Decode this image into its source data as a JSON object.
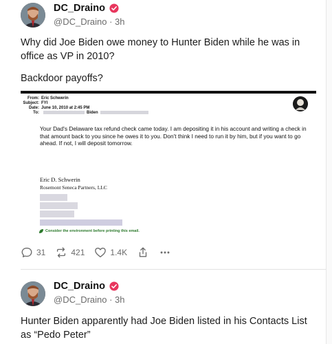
{
  "posts": [
    {
      "username": "DC_Draino",
      "handle_time": "@DC_Draino · 3h",
      "paragraphs": [
        "Why did Joe Biden owe money to Hunter Biden while he was in office as VP in 2010?",
        "Backdoor payoffs?"
      ],
      "email": {
        "from_label": "From:",
        "from_value": "Eric Schwerin",
        "subject_label": "Subject:",
        "subject_value": "FYI",
        "date_label": "Date:",
        "date_value": "June 10, 2010 at 2:45 PM",
        "to_label": "To:",
        "to_value": "Biden",
        "body": "Your Dad's Delaware tax refund check came today.  I am depositing it in his account and writing a check in that amount back to you since he owes it to you.  Don't think I need to run it by him, but if you want to go ahead.  If not, I will deposit tomorrow.",
        "signature_name": "Eric D. Schwerin",
        "signature_company": "Rosemont Seneca Partners, LLC",
        "eco_note": "Consider the environment before printing this email."
      },
      "actions": {
        "replies": "31",
        "reposts": "421",
        "likes": "1.4K"
      }
    },
    {
      "username": "DC_Draino",
      "handle_time": "@DC_Draino · 3h",
      "paragraphs": [
        "Hunter Biden apparently had Joe Biden listed in his Contacts List as “Pedo Peter”"
      ]
    }
  ],
  "colors": {
    "verified": "#e8365d",
    "text": "#1c1c1c",
    "muted": "#6b6b6b",
    "eco_green": "#2d7a2d"
  },
  "icons": [
    "verified-icon",
    "reply-icon",
    "repost-icon",
    "like-icon",
    "share-icon",
    "more-icon"
  ]
}
